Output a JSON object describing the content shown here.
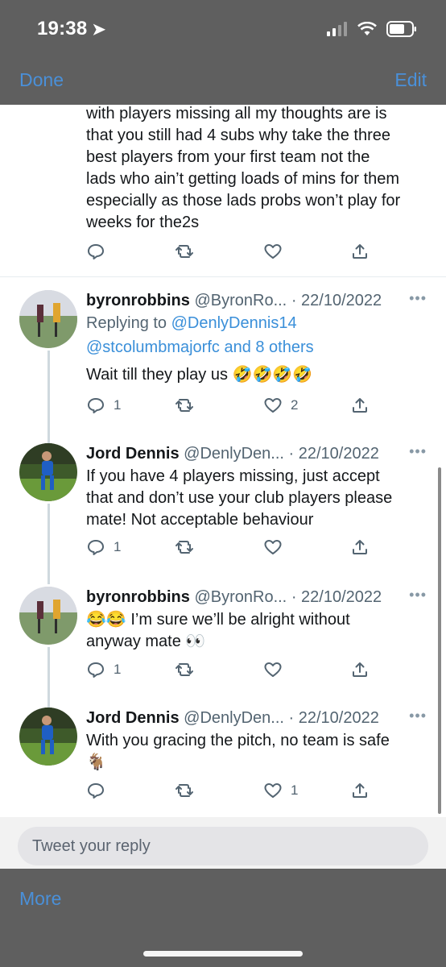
{
  "status": {
    "time": "19:38"
  },
  "nav": {
    "done": "Done",
    "edit": "Edit"
  },
  "top_tweet": {
    "lines": [
      "with players missing all my thoughts are is",
      "that you still had 4 subs  why take the three",
      "best players from your first team not the",
      "lads who ain’t getting loads of mins for them",
      "especially as those lads probs won’t play for",
      "weeks for the2s"
    ]
  },
  "tweets": [
    {
      "name": "byronrobbins",
      "handle": "@ByronRo...",
      "date": "· 22/10/2022",
      "more": "•••",
      "replying_label": "Replying to",
      "replying_to": "@DenlyDennis14",
      "replying_more": "@stcolumbmajorfc and 8 others",
      "text": "Wait till they play us 🤣🤣🤣🤣",
      "reply_count": "1",
      "like_count": "2"
    },
    {
      "name": "Jord Dennis",
      "handle": "@DenlyDen...",
      "date": "· 22/10/2022",
      "more": "•••",
      "lines": [
        "If you have 4 players missing, just accept",
        "that and don’t use your club players please",
        "mate! Not acceptable behaviour"
      ],
      "reply_count": "1",
      "like_count": ""
    },
    {
      "name": "byronrobbins",
      "handle": "@ByronRo...",
      "date": "· 22/10/2022",
      "more": "•••",
      "lines": [
        "😂😂 I’m sure we’ll be alright without",
        "anyway mate 👀"
      ],
      "reply_count": "1",
      "like_count": ""
    },
    {
      "name": "Jord Dennis",
      "handle": "@DenlyDen...",
      "date": "· 22/10/2022",
      "more": "•••",
      "lines": [
        "With you gracing the pitch, no team is safe",
        "🐐"
      ],
      "reply_count": "",
      "like_count": "1"
    }
  ],
  "reply_bar": {
    "placeholder": "Tweet your reply"
  },
  "bottom": {
    "more": "More"
  },
  "colors": {
    "accent": "#4a90d9",
    "link": "#3a8fd9",
    "chrome": "#5f5f5f"
  }
}
